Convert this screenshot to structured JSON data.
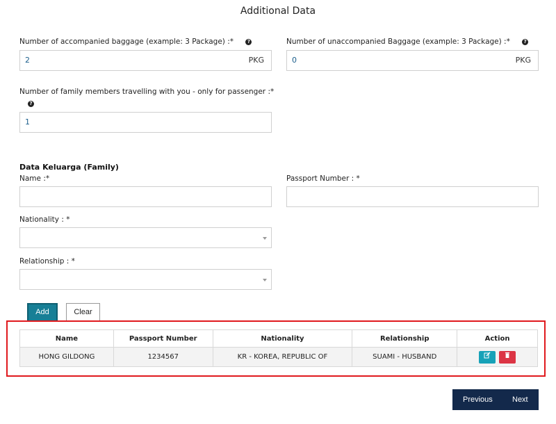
{
  "page": {
    "title": "Additional Data"
  },
  "accompanied": {
    "label": "Number of accompanied baggage (example: 3 Package) :*",
    "value": "2",
    "unit": "PKG"
  },
  "unaccompanied": {
    "label": "Number of unaccompanied Baggage (example: 3 Package) :*",
    "value": "0",
    "unit": "PKG"
  },
  "family_count": {
    "label": "Number of family members travelling with you - only for passenger :*",
    "value": "1"
  },
  "family_section": {
    "title": "Data Keluarga (Family)",
    "name_label": "Name :*",
    "passport_label": "Passport Number : *",
    "nationality_label": "Nationality : *",
    "relationship_label": "Relationship : *",
    "name_value": "",
    "passport_value": "",
    "nationality_value": "",
    "relationship_value": ""
  },
  "buttons": {
    "add": "Add",
    "clear": "Clear"
  },
  "table": {
    "headers": [
      "Name",
      "Passport Number",
      "Nationality",
      "Relationship",
      "Action"
    ],
    "rows": [
      {
        "name": "HONG GILDONG",
        "passport": "1234567",
        "nationality": "KR - KOREA, REPUBLIC OF",
        "relationship": "SUAMI - HUSBAND"
      }
    ]
  },
  "icons": {
    "help": "help-circle-icon",
    "edit": "edit-icon",
    "delete": "trash-icon",
    "caret": "chevron-down-icon"
  },
  "nav": {
    "previous": "Previous",
    "next": "Next"
  },
  "colors": {
    "primary_nav": "#13294b",
    "add_button": "#177f96",
    "highlight_border": "#e0191d",
    "edit": "#17a2b8",
    "delete": "#dc3545"
  }
}
